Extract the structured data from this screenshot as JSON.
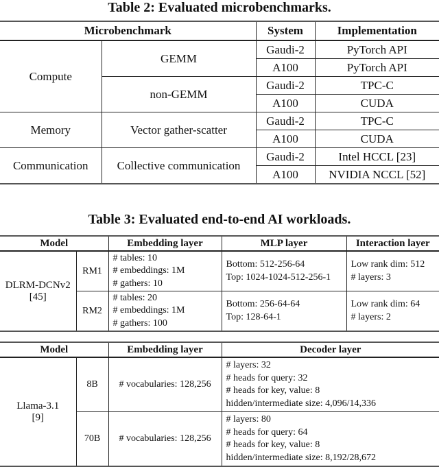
{
  "table2": {
    "caption": "Table 2: Evaluated microbenchmarks.",
    "headers": [
      "Microbenchmark",
      "System",
      "Implementation"
    ],
    "groups": [
      {
        "category": "Compute",
        "benchmarks": [
          {
            "name": "GEMM",
            "rows": [
              {
                "system": "Gaudi-2",
                "implementation": "PyTorch API"
              },
              {
                "system": "A100",
                "implementation": "PyTorch API"
              }
            ]
          },
          {
            "name": "non-GEMM",
            "rows": [
              {
                "system": "Gaudi-2",
                "implementation": "TPC-C"
              },
              {
                "system": "A100",
                "implementation": "CUDA"
              }
            ]
          }
        ]
      },
      {
        "category": "Memory",
        "benchmarks": [
          {
            "name": "Vector gather-scatter",
            "rows": [
              {
                "system": "Gaudi-2",
                "implementation": "TPC-C"
              },
              {
                "system": "A100",
                "implementation": "CUDA"
              }
            ]
          }
        ]
      },
      {
        "category": "Communication",
        "benchmarks": [
          {
            "name": "Collective communication",
            "rows": [
              {
                "system": "Gaudi-2",
                "implementation": "Intel HCCL [23]"
              },
              {
                "system": "A100",
                "implementation": "NVIDIA NCCL [52]"
              }
            ]
          }
        ]
      }
    ]
  },
  "table3": {
    "caption": "Table 3: Evaluated end-to-end AI workloads.",
    "dlrm": {
      "headers": [
        "Model",
        "Embedding layer",
        "MLP layer",
        "Interaction layer"
      ],
      "model": "DLRM-DCNv2",
      "model_ref": "[45]",
      "rows": [
        {
          "variant": "RM1",
          "embedding": [
            "# tables: 10",
            "# embeddings: 1M",
            "# gathers: 10"
          ],
          "mlp": [
            "Bottom: 512-256-64",
            "Top: 1024-1024-512-256-1"
          ],
          "interaction": [
            "Low rank dim: 512",
            "# layers: 3"
          ]
        },
        {
          "variant": "RM2",
          "embedding": [
            "# tables: 20",
            "# embeddings: 1M",
            "# gathers: 100"
          ],
          "mlp": [
            "Bottom: 256-64-64",
            "Top: 128-64-1"
          ],
          "interaction": [
            "Low rank dim: 64",
            "# layers: 2"
          ]
        }
      ]
    },
    "llama": {
      "headers": [
        "Model",
        "Embedding layer",
        "Decoder layer"
      ],
      "model": "Llama-3.1",
      "model_ref": "[9]",
      "rows": [
        {
          "variant": "8B",
          "embedding": "# vocabularies: 128,256",
          "decoder": [
            "# layers: 32",
            "# heads for query: 32",
            "# heads for key, value: 8",
            "hidden/intermediate size: 4,096/14,336"
          ]
        },
        {
          "variant": "70B",
          "embedding": "# vocabularies: 128,256",
          "decoder": [
            "# layers: 80",
            "# heads for query: 64",
            "# heads for key, value: 8",
            "hidden/intermediate size: 8,192/28,672"
          ]
        }
      ]
    }
  }
}
